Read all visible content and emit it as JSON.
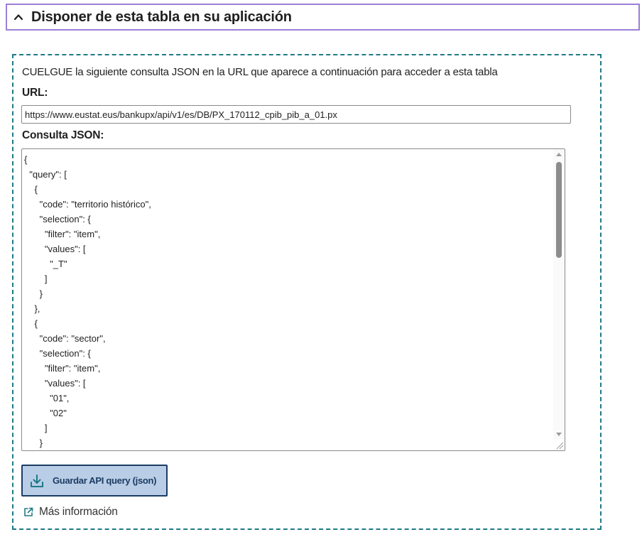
{
  "accordion": {
    "title": "Disponer de esta tabla en su aplicación",
    "icon": "chevron-up-icon"
  },
  "panel": {
    "intro": "CUELGUE la siguiente consulta JSON en la URL que aparece a continuación para acceder a esta tabla",
    "url_label": "URL:",
    "url_value": "https://www.eustat.eus/bankupx/api/v1/es/DB/PX_170112_cpib_pib_a_01.px",
    "json_label": "Consulta JSON:",
    "json_lines": [
      "{",
      "  \"query\": [",
      "    {",
      "      \"code\": \"territorio histórico\",",
      "      \"selection\": {",
      "        \"filter\": \"item\",",
      "        \"values\": [",
      "          \"_T\"",
      "        ]",
      "      }",
      "    },",
      "    {",
      "      \"code\": \"sector\",",
      "      \"selection\": {",
      "        \"filter\": \"item\",",
      "        \"values\": [",
      "          \"01\",",
      "          \"02\"",
      "        ]",
      "      }"
    ],
    "save_button": "Guardar API query (json)",
    "more_info": "Más información"
  },
  "colors": {
    "accordion_border": "#9b7fd6",
    "panel_border": "#1f7a86",
    "button_bg": "#b9cde6",
    "button_border": "#1c3c63",
    "link_icon": "#1f7a86"
  },
  "icons": {
    "save": "download-icon",
    "more": "external-link-icon"
  }
}
